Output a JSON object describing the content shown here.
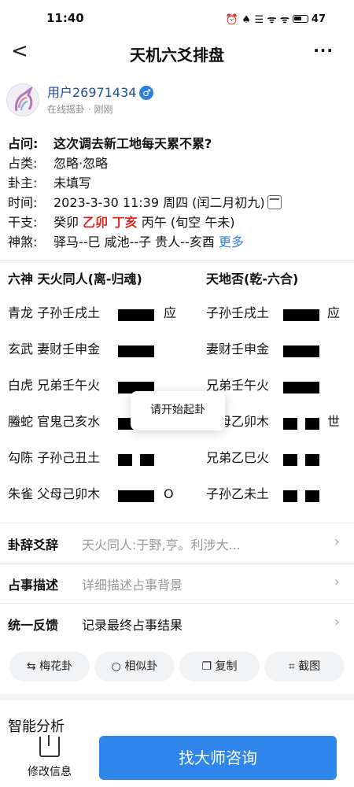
{
  "status": {
    "time": "11:40",
    "battery": "47",
    "icons": "⏰ ♠ ☰ ᯤ ᯤ"
  },
  "nav": {
    "back": "<",
    "title": "天机六爻排盘",
    "more": "···"
  },
  "user": {
    "name": "用户26971434",
    "gender_symbol": "♂",
    "sub": "在线摇卦 · 刚刚"
  },
  "info": {
    "question_label": "占问:",
    "question": "这次调去新工地每天累不累?",
    "type_label": "占类:",
    "type": "忽略·忽略",
    "owner_label": "卦主:",
    "owner": "未填写",
    "time_label": "时间:",
    "time": "2023-3-30 11:39 周四 (闰二月初九)",
    "ganzhi_label": "干支:",
    "ganzhi_a": "癸卯",
    "ganzhi_b": "乙卯 丁亥",
    "ganzhi_c": "丙午 (旬空 午未)",
    "shensha_label": "神煞:",
    "shensha": "驿马--巳  咸池--子  贵人--亥酉",
    "more_link": "更多"
  },
  "gua": {
    "head_left": "六神  天火同人(离-归魂)",
    "head_right": "天地否(乾-六合)",
    "rows": [
      {
        "left": "青龙 子孙壬戌土",
        "mark": "应",
        "right": "子孙壬戌土",
        "rmark": "应",
        "lyao": "yang",
        "ryao": "yang"
      },
      {
        "left": "玄武 妻财壬申金",
        "mark": "",
        "right": "妻财壬申金",
        "rmark": "",
        "lyao": "yang",
        "ryao": "yang"
      },
      {
        "left": "白虎 兄弟壬午火",
        "mark": "",
        "right": "兄弟壬午火",
        "rmark": "",
        "lyao": "yang",
        "ryao": "yang"
      },
      {
        "left": "螣蛇 官鬼己亥水",
        "mark": "",
        "right": "父母乙卯木",
        "rmark": "世",
        "lyao": "yang",
        "ryao": "yin"
      },
      {
        "left": "勾陈 子孙己丑土",
        "mark": "",
        "right": "兄弟乙巳火",
        "rmark": "",
        "lyao": "yin",
        "ryao": "yin"
      },
      {
        "left": "朱雀 父母己卯木",
        "mark": "O",
        "right": "子孙乙未土",
        "rmark": "",
        "lyao": "yang",
        "ryao": "yin"
      }
    ]
  },
  "toast": "请开始起卦",
  "list": {
    "gua_ci_title": "卦辞爻辞",
    "gua_ci_value": "天火同人:于野,亨。利涉大...",
    "desc_title": "占事描述",
    "desc_placeholder": "详细描述占事背景",
    "feedback_title": "统一反馈",
    "feedback_value": "记录最终占事结果",
    "chevron": "›"
  },
  "tools": [
    {
      "icon": "⇆",
      "label": "梅花卦"
    },
    {
      "icon": "○",
      "label": "相似卦"
    },
    {
      "icon": "❐",
      "label": "复制"
    },
    {
      "icon": "⌗",
      "label": "截图"
    }
  ],
  "ai_title": "智能分析",
  "bottom": {
    "edit_label": "修改信息",
    "master_label": "找大师咨询"
  },
  "colors": {
    "accent": "#2f86ea",
    "red": "#e0241b",
    "link": "#2f7fe0"
  }
}
